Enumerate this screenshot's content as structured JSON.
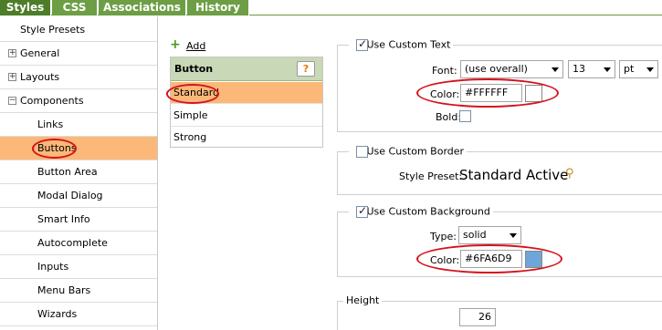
{
  "tabs": [
    {
      "label": "Styles",
      "active": true
    },
    {
      "label": "CSS",
      "active": false
    },
    {
      "label": "Associations",
      "active": false
    },
    {
      "label": "History",
      "active": false
    }
  ],
  "nav": {
    "items": [
      {
        "label": "Style Presets",
        "level": 0,
        "expander": ""
      },
      {
        "label": "General",
        "level": 0,
        "expander": "+"
      },
      {
        "label": "Layouts",
        "level": 0,
        "expander": "+"
      },
      {
        "label": "Components",
        "level": 0,
        "expander": "−"
      },
      {
        "label": "Links",
        "level": 1,
        "expander": ""
      },
      {
        "label": "Buttons",
        "level": 1,
        "expander": "",
        "active": true
      },
      {
        "label": "Button Area",
        "level": 1,
        "expander": ""
      },
      {
        "label": "Modal Dialog",
        "level": 1,
        "expander": ""
      },
      {
        "label": "Smart Info",
        "level": 1,
        "expander": ""
      },
      {
        "label": "Autocomplete",
        "level": 1,
        "expander": ""
      },
      {
        "label": "Inputs",
        "level": 1,
        "expander": ""
      },
      {
        "label": "Menu Bars",
        "level": 1,
        "expander": ""
      },
      {
        "label": "Wizards",
        "level": 1,
        "expander": ""
      }
    ]
  },
  "list": {
    "add_label": "Add",
    "header": "Button",
    "help_label": "?",
    "rows": [
      "Standard",
      "Simple",
      "Strong"
    ]
  },
  "text_panel": {
    "legend": "Use Custom Text",
    "checked": true,
    "font_label": "Font:",
    "font_value": "(use overall)",
    "size_value": "13",
    "unit_value": "pt",
    "color_label": "Color:",
    "color_value": "#FFFFFF",
    "swatch_color": "#FFFFFF",
    "bold_label": "Bold:"
  },
  "border_panel": {
    "legend": "Use Custom Border",
    "checked": false,
    "preset_label": "Style Preset:",
    "preset_value": "Standard Active"
  },
  "background_panel": {
    "legend": "Use Custom Background",
    "checked": true,
    "type_label": "Type:",
    "type_value": "solid",
    "color_label": "Color:",
    "color_value": "#6FA6D9",
    "swatch_color": "#6FA6D9"
  },
  "height_panel": {
    "legend": "Height",
    "value": "26"
  },
  "colors": {
    "tab_green": "#6d9e45",
    "highlight_orange": "#fbb879",
    "annotation_red": "#d5121b"
  }
}
